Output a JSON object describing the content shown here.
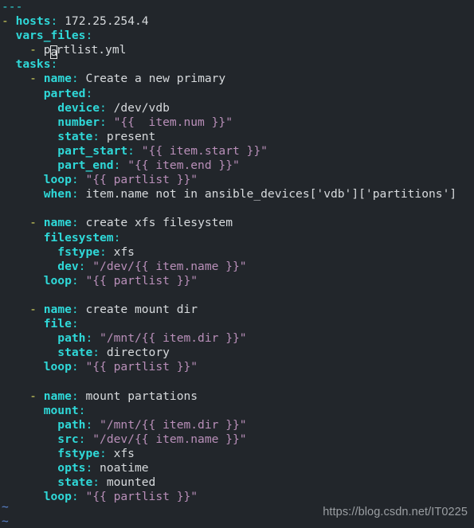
{
  "app": {
    "name": "vim",
    "mode": "normal",
    "background_color": "#22262b"
  },
  "colors": {
    "key": "#2fd8d8",
    "value": "#d7dadd",
    "string": "#b98fb9",
    "list_dash": "#d8d85f",
    "tilde": "#5a84cf",
    "watermark": "#9b9fa3",
    "cursor_outline": "#e6e6e6"
  },
  "cursor": {
    "char": "a",
    "line_number": 4,
    "column": 8,
    "on_text": "partlist.yml"
  },
  "editor": {
    "filetype": "yaml",
    "lines": [
      {
        "indent": 0,
        "doc_start": "---"
      },
      {
        "indent": 0,
        "dash": "-",
        "key": "hosts",
        "value": "172.25.254.4"
      },
      {
        "indent": 2,
        "key": "vars_files",
        "value": ""
      },
      {
        "indent": 4,
        "dash": "-",
        "value_cursor": "partlist.yml"
      },
      {
        "indent": 2,
        "key": "tasks",
        "value": ""
      },
      {
        "indent": 4,
        "dash": "-",
        "key": "name",
        "value": "Create a new primary"
      },
      {
        "indent": 6,
        "key": "parted",
        "value": ""
      },
      {
        "indent": 8,
        "key": "device",
        "value": "/dev/vdb"
      },
      {
        "indent": 8,
        "key": "number",
        "string": "\"{{  item.num }}\""
      },
      {
        "indent": 8,
        "key": "state",
        "value": "present"
      },
      {
        "indent": 8,
        "key": "part_start",
        "string": "\"{{ item.start }}\""
      },
      {
        "indent": 8,
        "key": "part_end",
        "string": "\"{{ item.end }}\""
      },
      {
        "indent": 6,
        "key": "loop",
        "string": "\"{{ partlist }}\""
      },
      {
        "indent": 6,
        "key": "when",
        "value": "item.name not in ansible_devices['vdb']['partitions']"
      },
      {
        "blank": true
      },
      {
        "indent": 4,
        "dash": "-",
        "key": "name",
        "value": "create xfs filesystem"
      },
      {
        "indent": 6,
        "key": "filesystem",
        "value": ""
      },
      {
        "indent": 8,
        "key": "fstype",
        "value": "xfs"
      },
      {
        "indent": 8,
        "key": "dev",
        "string": "\"/dev/{{ item.name }}\""
      },
      {
        "indent": 6,
        "key": "loop",
        "string": "\"{{ partlist }}\""
      },
      {
        "blank": true
      },
      {
        "indent": 4,
        "dash": "-",
        "key": "name",
        "value": "create mount dir"
      },
      {
        "indent": 6,
        "key": "file",
        "value": ""
      },
      {
        "indent": 8,
        "key": "path",
        "string": "\"/mnt/{{ item.dir }}\""
      },
      {
        "indent": 8,
        "key": "state",
        "value": "directory"
      },
      {
        "indent": 6,
        "key": "loop",
        "string": "\"{{ partlist }}\""
      },
      {
        "blank": true
      },
      {
        "indent": 4,
        "dash": "-",
        "key": "name",
        "value": "mount partations"
      },
      {
        "indent": 6,
        "key": "mount",
        "value": ""
      },
      {
        "indent": 8,
        "key": "path",
        "string": "\"/mnt/{{ item.dir }}\""
      },
      {
        "indent": 8,
        "key": "src",
        "string": "\"/dev/{{ item.name }}\""
      },
      {
        "indent": 8,
        "key": "fstype",
        "value": "xfs"
      },
      {
        "indent": 8,
        "key": "opts",
        "value": "noatime"
      },
      {
        "indent": 8,
        "key": "state",
        "value": "mounted"
      },
      {
        "indent": 6,
        "key": "loop",
        "string": "\"{{ partlist }}\""
      }
    ],
    "empty_line_markers": [
      "~",
      "~"
    ]
  },
  "watermark": {
    "text": "https://blog.csdn.net/IT0225"
  }
}
